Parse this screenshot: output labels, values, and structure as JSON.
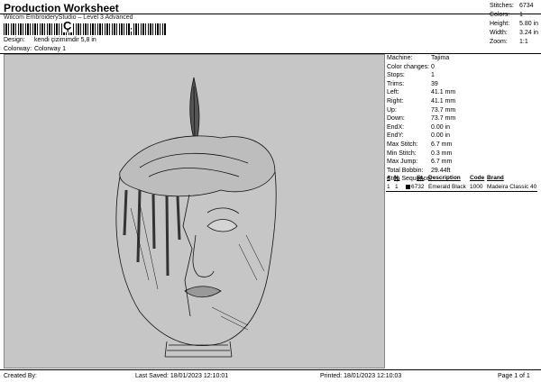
{
  "header": {
    "title": "Production Worksheet",
    "software": "Wilcom EmbroideryStudio – Level 3 Advanced",
    "barcode_glyph": "Ç",
    "barcode_tail": ","
  },
  "design": {
    "label": "Design:",
    "value": "kendi çizimimdir 5,8 in"
  },
  "colorway": {
    "label": "Colorway:",
    "value": "Colorway 1"
  },
  "stats": [
    {
      "label": "Stitches:",
      "value": "6734"
    },
    {
      "label": "Colors:",
      "value": "1"
    },
    {
      "label": "Height:",
      "value": "5.80 in"
    },
    {
      "label": "Width:",
      "value": "3.24 in"
    },
    {
      "label": "Zoom:",
      "value": "1:1"
    }
  ],
  "details": [
    {
      "label": "Machine:",
      "value": "Tajima"
    },
    {
      "label": "Color changes:",
      "value": "0"
    },
    {
      "label": "Stops:",
      "value": "1"
    },
    {
      "label": "Trims:",
      "value": "39"
    },
    {
      "label": "Left:",
      "value": "41.1 mm"
    },
    {
      "label": "Right:",
      "value": "41.1 mm"
    },
    {
      "label": "Up:",
      "value": "73.7 mm"
    },
    {
      "label": "Down:",
      "value": "73.7 mm"
    },
    {
      "label": "EndX:",
      "value": "0.00 in"
    },
    {
      "label": "EndY:",
      "value": "0.00 in"
    },
    {
      "label": "Max Stitch:",
      "value": "6.7 mm"
    },
    {
      "label": "Min Stitch:",
      "value": "0.3 mm"
    },
    {
      "label": "Max Jump:",
      "value": "6.7 mm"
    },
    {
      "label": "Total Bobbin:",
      "value": "29.44ft"
    },
    {
      "label": "Stop Sequence:",
      "value": ""
    }
  ],
  "stop_table": {
    "headers": [
      "#",
      "N.",
      "St.",
      "Description",
      "Code",
      "Brand"
    ],
    "rows": [
      {
        "num": "1",
        "n": "1",
        "st": "6732",
        "description": "Emerald Black",
        "code": "1000",
        "brand": "Madeira Classic 40",
        "color": "#050505"
      }
    ]
  },
  "footer": {
    "created_by": "Created By:",
    "last_saved": "Last Saved: 18/01/2023 12:10:01",
    "printed": "Printed: 18/01/2023 12:10:03",
    "page": "Page 1 of 1"
  }
}
